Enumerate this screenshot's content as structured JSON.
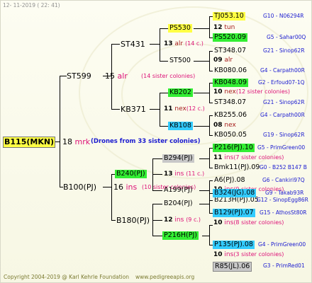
{
  "header": {
    "date": "12- 11-2019 ( 22: 41)"
  },
  "footer": {
    "copyright": "Copyright 2004-2019 @ Karl Kehrle Foundation",
    "url": "www.pedigreeapis.org"
  },
  "root": {
    "id": "B115(MKN)",
    "num": "18",
    "code": "mrk",
    "note": "(Drones from 33 sister colonies)"
  },
  "g1": [
    {
      "id": "ST599",
      "num": "15",
      "code": "alr",
      "note": "(14 sister colonies)"
    },
    {
      "id": "B100(PJ)",
      "num": "16",
      "code": "ins",
      "note": "(10 sister colonies)"
    }
  ],
  "g2": [
    {
      "id": "ST431",
      "num": "13",
      "code": "alr",
      "note": "(14 c.)"
    },
    {
      "id": "KB371",
      "num": "11",
      "code": "nex",
      "note": "(12 c.)"
    },
    {
      "id": "B240(PJ)",
      "num": "13",
      "code": "ins",
      "note": "(11 c.)"
    },
    {
      "id": "B180(PJ)",
      "num": "12",
      "code": "ins",
      "note": "(9 c.)"
    }
  ],
  "g3": [
    {
      "id": "PS530",
      "num": "12",
      "code": "tun",
      "note": ""
    },
    {
      "id": "ST500",
      "num": "09",
      "code": "alr",
      "note": ""
    },
    {
      "id": "KB202",
      "num": "10",
      "code": "nex",
      "note": "(12 sister colonies)"
    },
    {
      "id": "KB108",
      "num": "08",
      "code": "nex",
      "note": ""
    },
    {
      "id": "B294(PJ)",
      "num": "11",
      "code": "ins",
      "note": "(7 sister colonies)"
    },
    {
      "id": "A199(PJ)",
      "num": "10",
      "code": "ins",
      "note": "(9 sister colonies)"
    },
    {
      "id": "B204(PJ)",
      "num": "10",
      "code": "ins",
      "note": "(8 sister colonies)"
    },
    {
      "id": "P216H(PJ)",
      "num": "10",
      "code": "ins",
      "note": "(3 sister colonies)"
    }
  ],
  "g4": [
    {
      "id": "TJ053.10",
      "breeder": "G10 - N06294R"
    },
    {
      "id": "PS520.09",
      "breeder": "G5 - Sahar00Q"
    },
    {
      "id": "ST348.07",
      "breeder": "G21 - Sinop62R"
    },
    {
      "id": "KB080.06",
      "breeder": "G4 - Carpath00R"
    },
    {
      "id": "KB048.09",
      "breeder": "G2 - Erfoud07-1Q"
    },
    {
      "id": "ST348.07",
      "breeder": "G21 - Sinop62R"
    },
    {
      "id": "KB255.06",
      "breeder": "G4 - Carpath00R"
    },
    {
      "id": "KB050.05",
      "breeder": "G19 - Sinop62R"
    },
    {
      "id": "P216(PJ).10",
      "breeder": "G5 - PrimGreen00"
    },
    {
      "id": "Bmk11(PJ).09",
      "breeder": "G0 - B252 B147 B"
    },
    {
      "id": "A6(PJ).08",
      "breeder": "G6 - Cankiri97Q"
    },
    {
      "id": "B213H(PJ).05",
      "breeder": "G12 - SinopEgg86R"
    },
    {
      "id": "B324(JG).08",
      "breeder": "G9 - Takab93R"
    },
    {
      "id": "B129(PJ).07",
      "breeder": "G15 - AthosSt80R"
    },
    {
      "id": "P135(PJ).08",
      "breeder": "G4 - PrimGreen00"
    },
    {
      "id": "R85(JL).06",
      "breeder": "G3 - PrimRed01"
    }
  ]
}
